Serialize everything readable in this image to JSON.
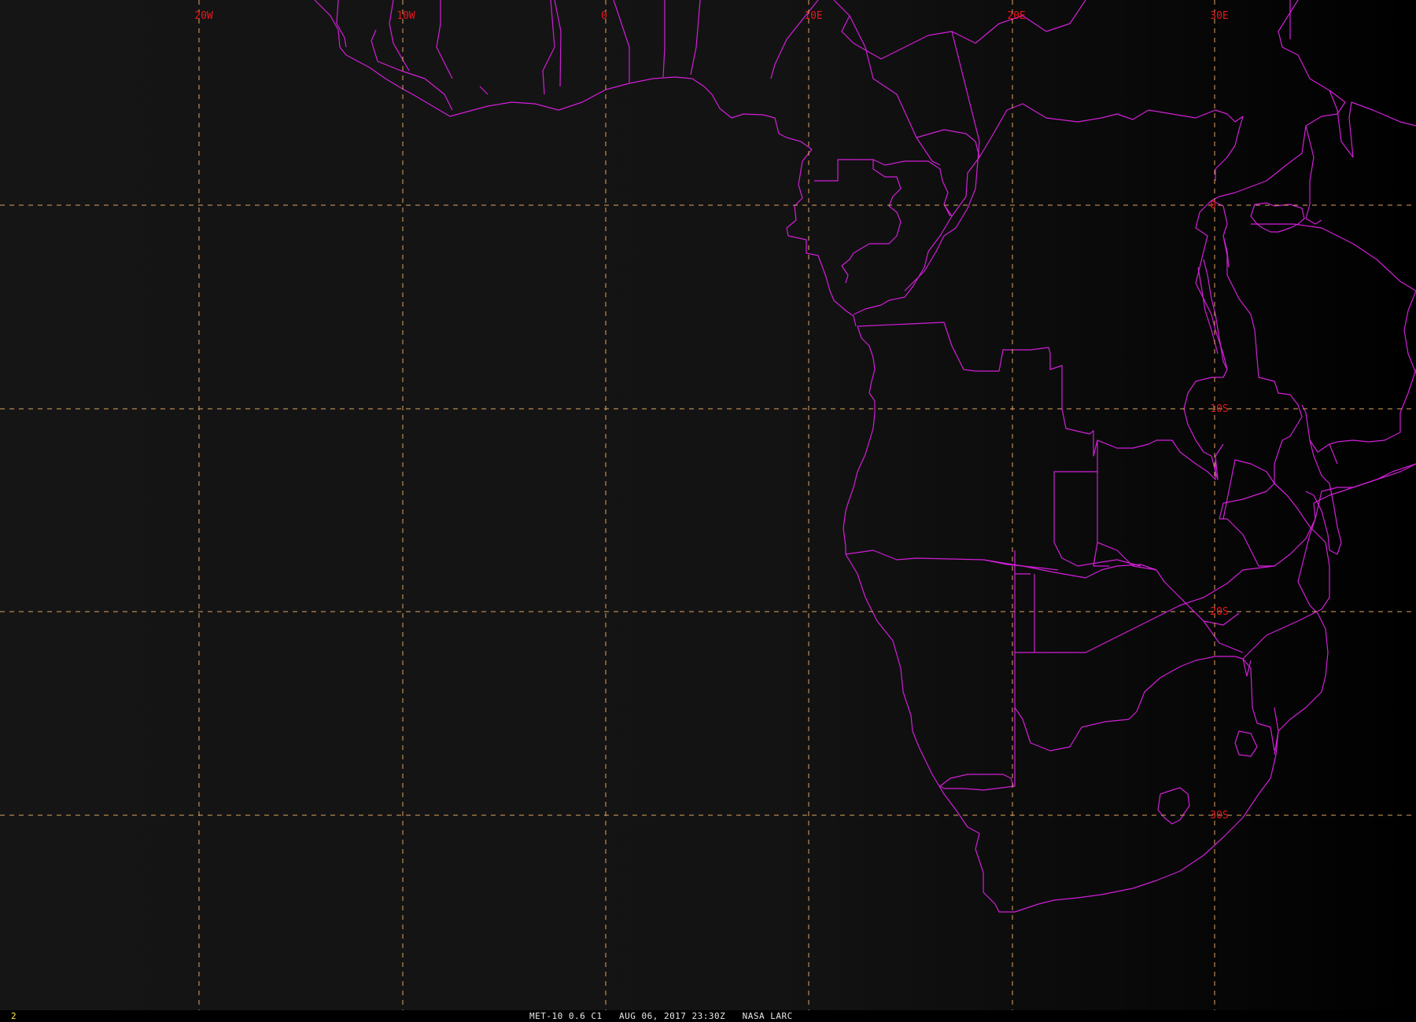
{
  "map": {
    "longitude_labels": [
      "20W",
      "10W",
      "0",
      "10E",
      "20E",
      "30E"
    ],
    "latitude_labels": [
      "0",
      "10S",
      "20S",
      "30S"
    ],
    "colors": {
      "background": "#141414",
      "borders": "#d21fd8",
      "gridlines": "#e0a262",
      "grid_labels": "#e6181c"
    }
  },
  "status_bar": {
    "frame_number": "2",
    "caption": "MET-10 0.6 C1   AUG 06, 2017 23:30Z   NASA LARC"
  }
}
